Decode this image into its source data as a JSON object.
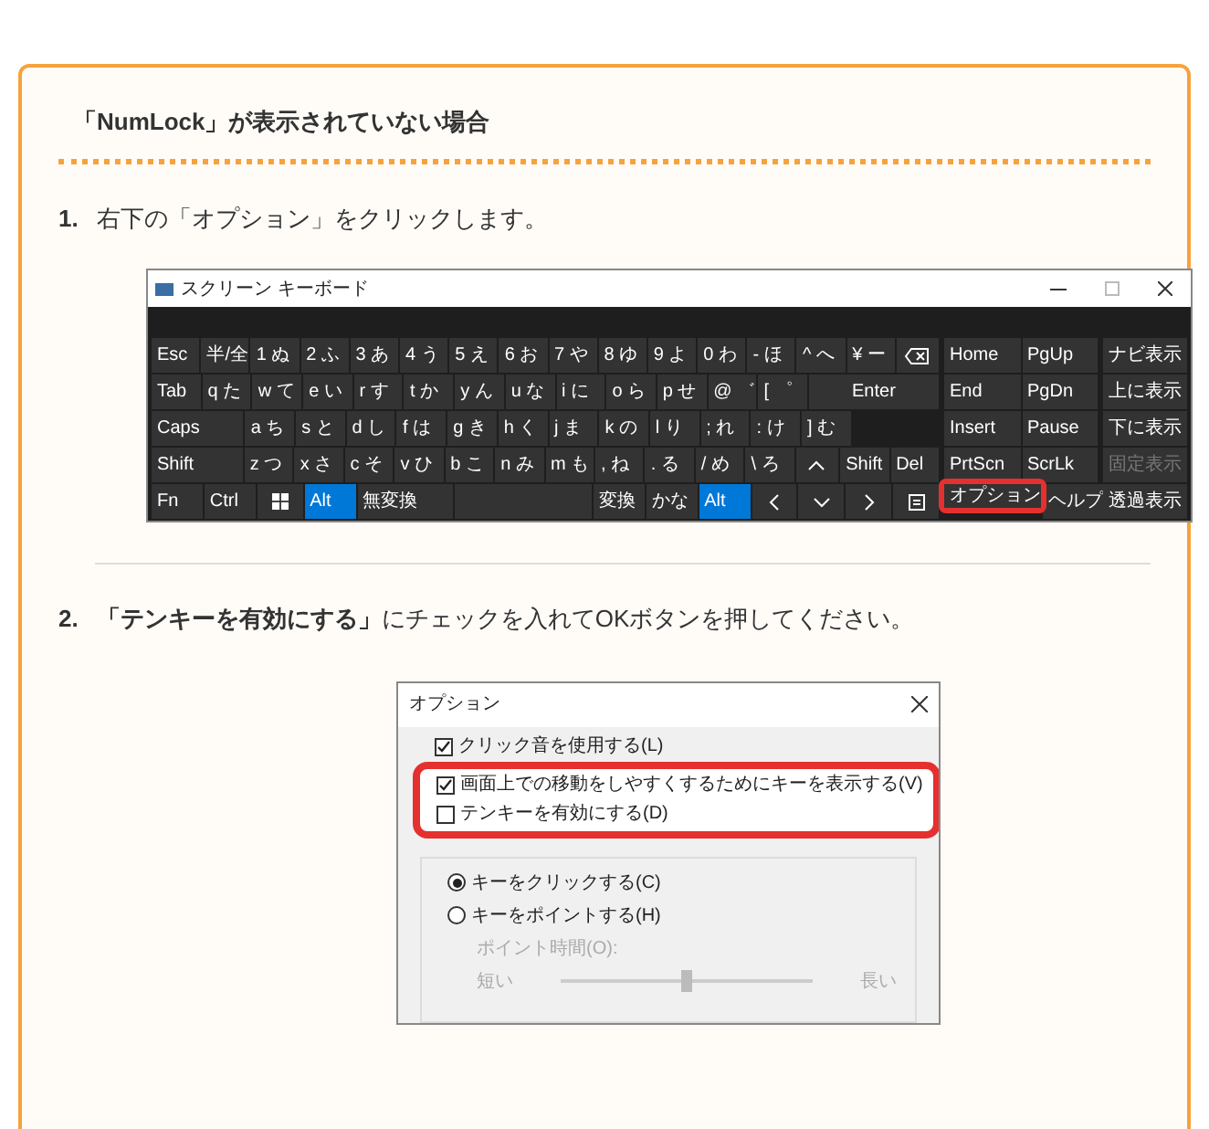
{
  "heading": "「NumLock」が表示されていない場合",
  "steps": [
    {
      "number": "1.",
      "text": "右下の「オプション」をクリックします。"
    },
    {
      "number": "2.",
      "text": "**「テンキーを有効にする」**にチェックを入れてOKボタンを押してください。"
    }
  ],
  "keyboard_window": {
    "title": "スクリーン キーボード",
    "main_rows": [
      [
        {
          "kind": "key",
          "label": "Esc",
          "on": false
        },
        {
          "kind": "key",
          "label": "半/全",
          "on": false
        },
        {
          "kind": "key",
          "label": "1 ぬ",
          "on": false
        },
        {
          "kind": "key",
          "label": "2 ふ",
          "on": false
        },
        {
          "kind": "key",
          "label": "3 あ",
          "on": false
        },
        {
          "kind": "key",
          "label": "4 う",
          "on": false
        },
        {
          "kind": "key",
          "label": "5 え",
          "on": false
        },
        {
          "kind": "key",
          "label": "6 お",
          "on": false
        },
        {
          "kind": "key",
          "label": "7 や",
          "on": false
        },
        {
          "kind": "key",
          "label": "8 ゆ",
          "on": false
        },
        {
          "kind": "key",
          "label": "9 よ",
          "on": false
        },
        {
          "kind": "key",
          "label": "0 わ",
          "on": false
        },
        {
          "kind": "key",
          "label": "- ほ",
          "on": false
        },
        {
          "kind": "key",
          "label": "^ へ",
          "on": false
        },
        {
          "kind": "key",
          "label": "¥ ー",
          "on": false
        },
        {
          "kind": "backspace",
          "on": false
        }
      ],
      [
        {
          "kind": "key",
          "label": "Tab",
          "on": false
        },
        {
          "kind": "key",
          "label": "q た",
          "on": false
        },
        {
          "kind": "key",
          "label": "w て",
          "on": false
        },
        {
          "kind": "key",
          "label": "e い",
          "on": false
        },
        {
          "kind": "key",
          "label": "r す",
          "on": false
        },
        {
          "kind": "key",
          "label": "t か",
          "on": false
        },
        {
          "kind": "key",
          "label": "y ん",
          "on": false
        },
        {
          "kind": "key",
          "label": "u な",
          "on": false
        },
        {
          "kind": "key",
          "label": "i に",
          "on": false
        },
        {
          "kind": "key",
          "label": "o ら",
          "on": false
        },
        {
          "kind": "key",
          "label": "p せ",
          "on": false
        },
        {
          "kind": "key",
          "label": "@ ゛",
          "on": false
        },
        {
          "kind": "key",
          "label": "[ ゜",
          "on": false
        },
        {
          "kind": "enter",
          "label": "Enter",
          "on": false
        }
      ],
      [
        {
          "kind": "wide",
          "label": "Caps",
          "on": false
        },
        {
          "kind": "key",
          "label": "a ち",
          "on": false
        },
        {
          "kind": "key",
          "label": "s と",
          "on": false
        },
        {
          "kind": "key",
          "label": "d し",
          "on": false
        },
        {
          "kind": "key",
          "label": "f は",
          "on": false
        },
        {
          "kind": "key",
          "label": "g き",
          "on": false
        },
        {
          "kind": "key",
          "label": "h く",
          "on": false
        },
        {
          "kind": "key",
          "label": "j ま",
          "on": false
        },
        {
          "kind": "key",
          "label": "k の",
          "on": false
        },
        {
          "kind": "key",
          "label": "l り",
          "on": false
        },
        {
          "kind": "key",
          "label": "; れ",
          "on": false
        },
        {
          "kind": "key",
          "label": ": け",
          "on": false
        },
        {
          "kind": "key",
          "label": "] む",
          "on": false
        },
        {
          "kind": "blank"
        }
      ],
      [
        {
          "kind": "wide",
          "label": "Shift",
          "on": false
        },
        {
          "kind": "key",
          "label": "z つ",
          "on": false
        },
        {
          "kind": "key",
          "label": "x さ",
          "on": false
        },
        {
          "kind": "key",
          "label": "c そ",
          "on": false
        },
        {
          "kind": "key",
          "label": "v ひ",
          "on": false
        },
        {
          "kind": "key",
          "label": "b こ",
          "on": false
        },
        {
          "kind": "key",
          "label": "n み",
          "on": false
        },
        {
          "kind": "key",
          "label": "m も",
          "on": false
        },
        {
          "kind": "key",
          "label": ", ね",
          "on": false
        },
        {
          "kind": "key",
          "label": ". る",
          "on": false
        },
        {
          "kind": "key",
          "label": "/ め",
          "on": false
        },
        {
          "kind": "key",
          "label": "\\ ろ",
          "on": false
        },
        {
          "kind": "up",
          "on": false
        },
        {
          "kind": "key",
          "label": "Shift",
          "on": false
        },
        {
          "kind": "key",
          "label": "Del",
          "on": false
        }
      ],
      [
        {
          "kind": "key",
          "label": "Fn",
          "on": false
        },
        {
          "kind": "key",
          "label": "Ctrl",
          "on": false
        },
        {
          "kind": "windows",
          "on": false
        },
        {
          "kind": "key",
          "label": "Alt",
          "on": true
        },
        {
          "kind": "wide",
          "label": "無変換",
          "on": false
        },
        {
          "kind": "space",
          "on": false
        },
        {
          "kind": "key",
          "label": "変換",
          "on": false
        },
        {
          "kind": "key",
          "label": "かな",
          "on": false
        },
        {
          "kind": "key",
          "label": "Alt",
          "on": true
        },
        {
          "kind": "left",
          "on": false
        },
        {
          "kind": "down",
          "on": false
        },
        {
          "kind": "right",
          "on": false
        },
        {
          "kind": "menu",
          "on": false
        }
      ]
    ],
    "nav_rows": [
      [
        {
          "label": "Home",
          "highlighted": false
        },
        {
          "label": "PgUp",
          "highlighted": false
        }
      ],
      [
        {
          "label": "End",
          "highlighted": false
        },
        {
          "label": "PgDn",
          "highlighted": false
        }
      ],
      [
        {
          "label": "Insert",
          "highlighted": false
        },
        {
          "label": "Pause",
          "highlighted": false
        }
      ],
      [
        {
          "label": "PrtScn",
          "highlighted": false
        },
        {
          "label": "ScrLk",
          "highlighted": false
        }
      ],
      [
        {
          "label": "オプション",
          "highlighted": true
        },
        {
          "label": "ヘルプ",
          "highlighted": false
        }
      ]
    ],
    "side_keys": [
      {
        "label": "ナビ表示",
        "disabled": false
      },
      {
        "label": "上に表示",
        "disabled": false
      },
      {
        "label": "下に表示",
        "disabled": false
      },
      {
        "label": "固定表示",
        "disabled": true
      },
      {
        "label": "透過表示",
        "disabled": false
      }
    ]
  },
  "options_dialog": {
    "title": "オプション",
    "checkboxes": [
      {
        "label": "クリック音を使用する(L)",
        "checked": true,
        "highlighted": false
      },
      {
        "label": "画面上での移動をしやすくするためにキーを表示する(V)",
        "checked": true,
        "highlighted": true
      },
      {
        "label": "テンキーを有効にする(D)",
        "checked": false,
        "highlighted": true
      }
    ],
    "radios": [
      {
        "label": "キーをクリックする(C)",
        "selected": true
      },
      {
        "label": "キーをポイントする(H)",
        "selected": false
      }
    ],
    "point_time": {
      "label": "ポイント時間(O):",
      "min": "短い",
      "max": "長い",
      "level": 0.5
    }
  }
}
